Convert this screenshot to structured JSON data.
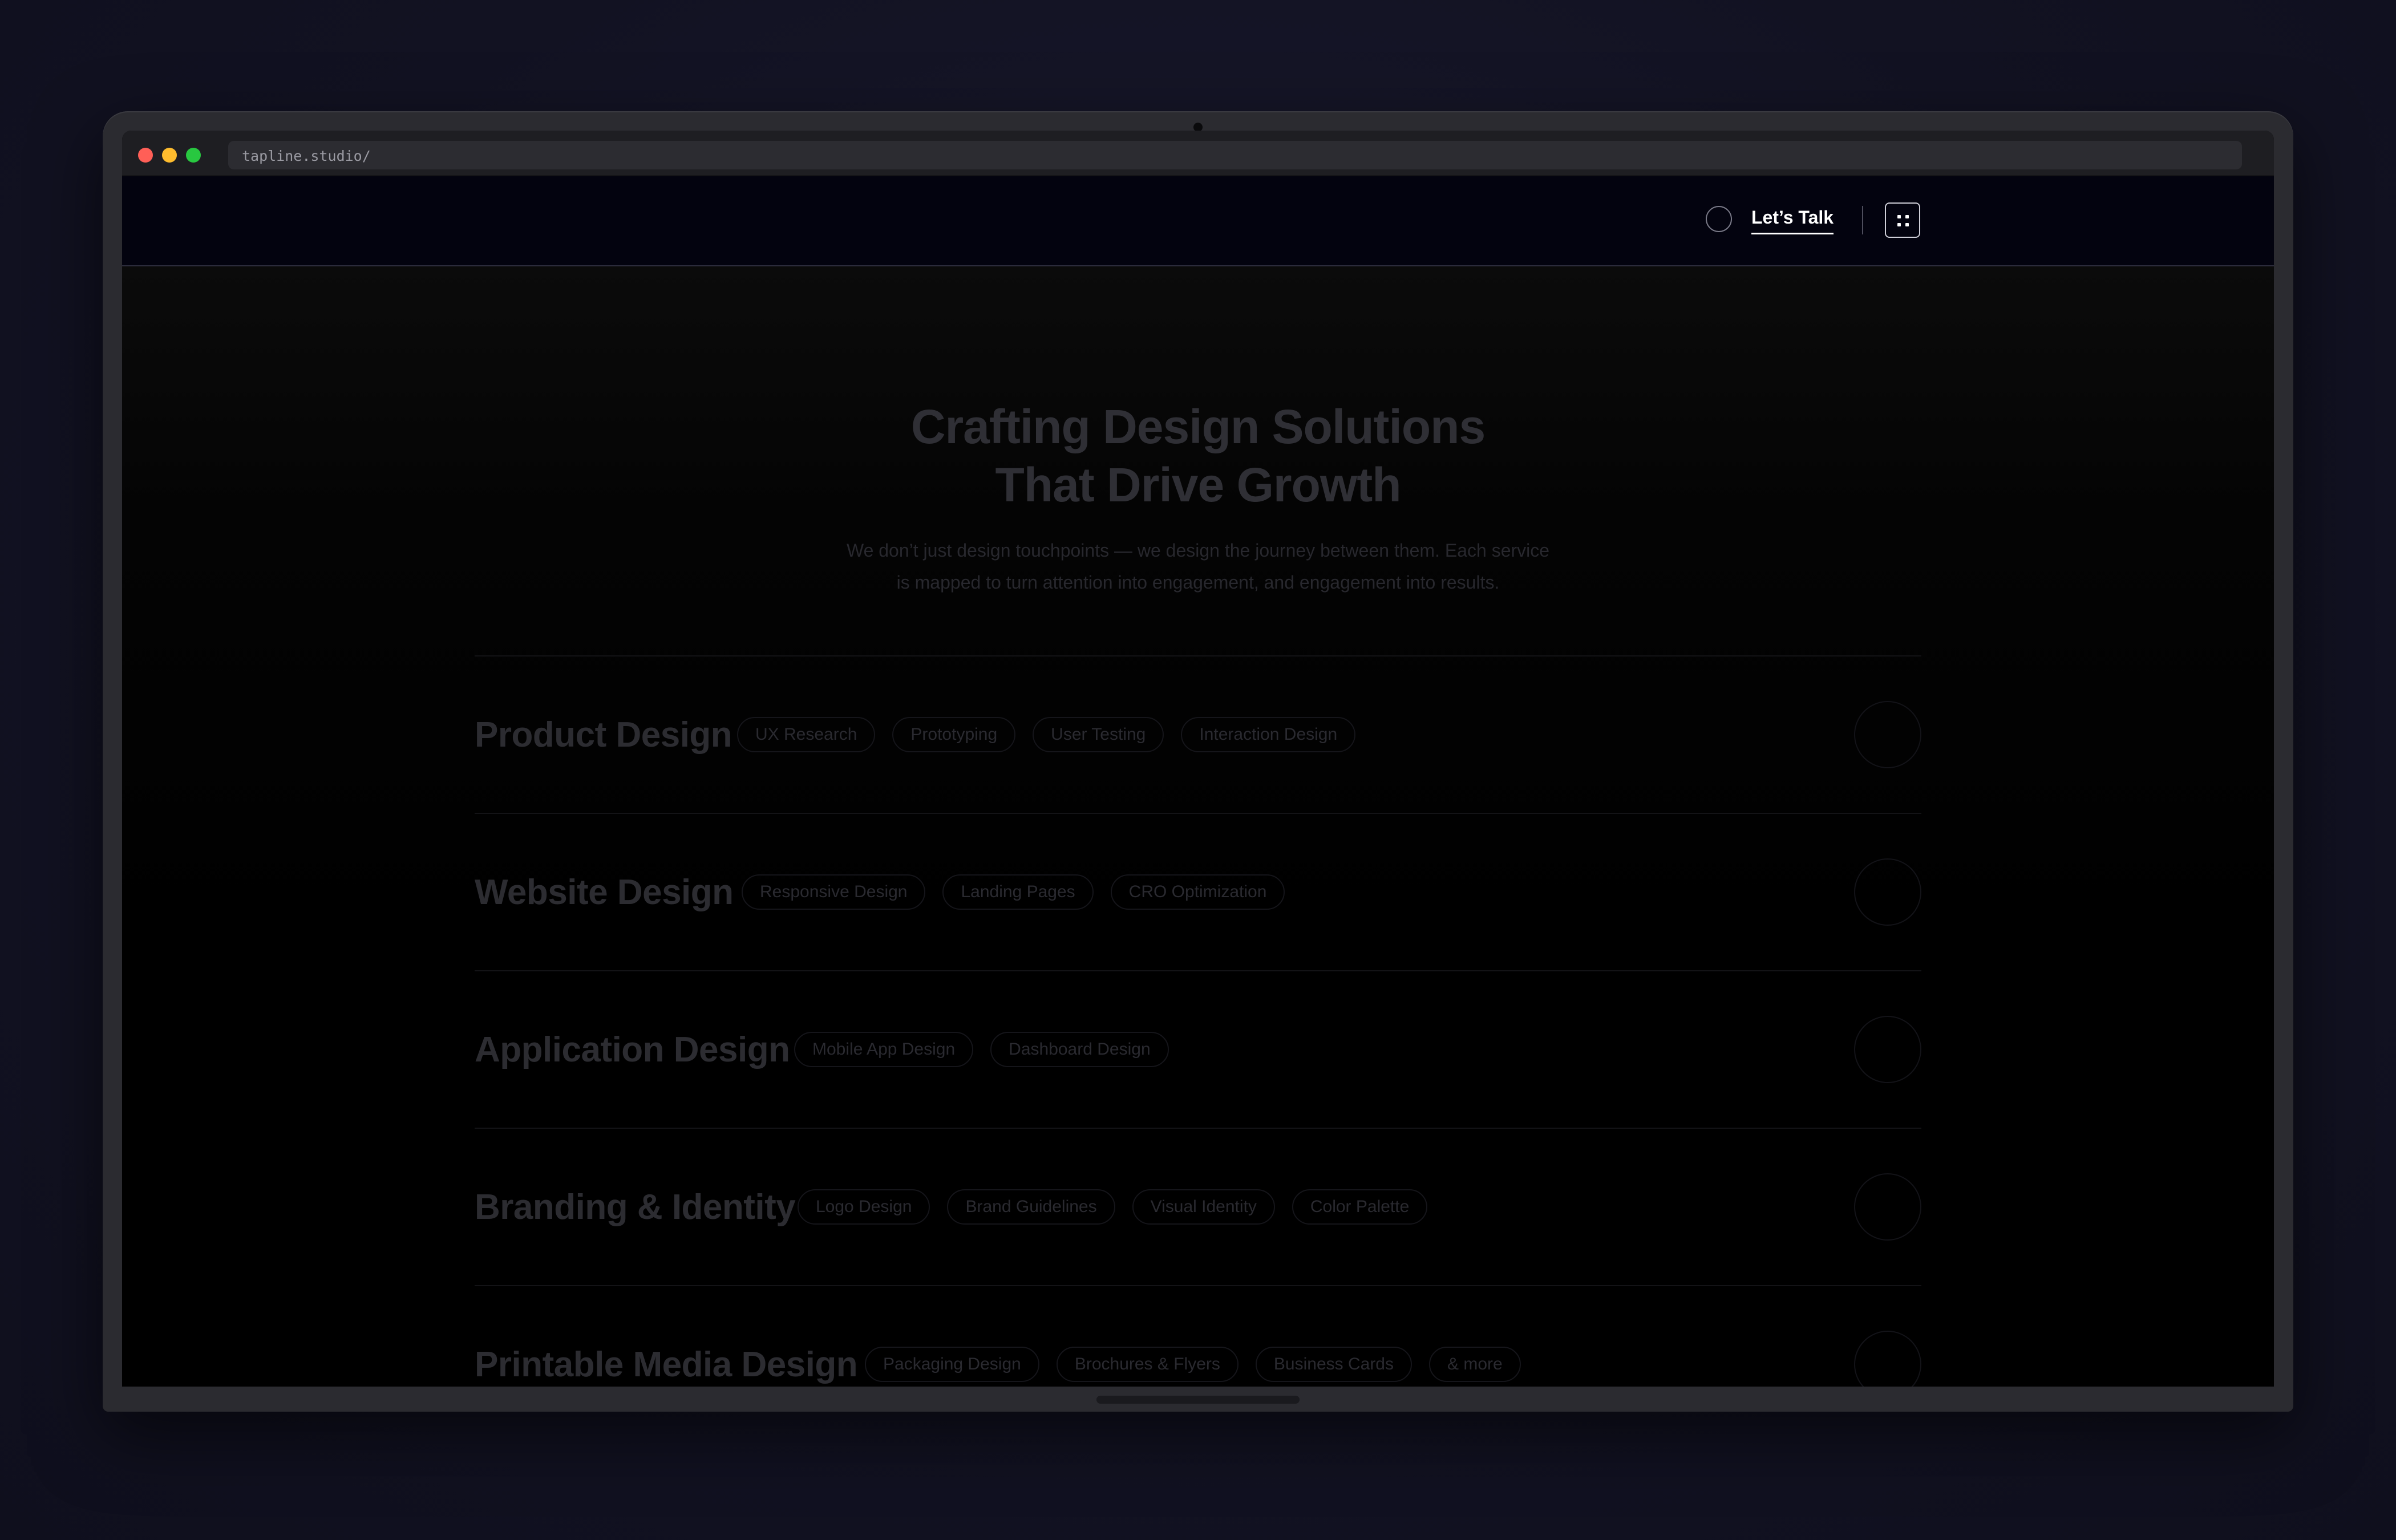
{
  "browser": {
    "url": "tapline.studio/"
  },
  "header": {
    "cta_label": "Let’s Talk"
  },
  "hero": {
    "title_line1": "Crafting Design Solutions",
    "title_line2": "That Drive Growth",
    "subtitle_line1": "We don’t just design touchpoints — we design the journey between them. Each service",
    "subtitle_line2": "is mapped to turn attention into engagement, and engagement into results."
  },
  "services": [
    {
      "title": "Product Design",
      "tags": [
        "UX Research",
        "Prototyping",
        "User Testing",
        "Interaction Design"
      ]
    },
    {
      "title": "Website Design",
      "tags": [
        "Responsive Design",
        "Landing Pages",
        "CRO Optimization"
      ]
    },
    {
      "title": "Application Design",
      "tags": [
        "Mobile App Design",
        "Dashboard Design"
      ]
    },
    {
      "title": "Branding & Identity",
      "tags": [
        "Logo Design",
        "Brand Guidelines",
        "Visual Identity",
        "Color Palette"
      ]
    },
    {
      "title": "Printable Media Design",
      "tags": [
        "Packaging Design",
        "Brochures & Flyers",
        "Business Cards",
        "& more"
      ]
    }
  ],
  "colors": {
    "header_bg": "#03030f",
    "page_bg": "#000000",
    "accent_text": "#ffffff"
  },
  "icons": {
    "menu": "grid-dots-icon",
    "talk_indicator": "circle-icon",
    "row_action": "arrow-circle-icon"
  }
}
